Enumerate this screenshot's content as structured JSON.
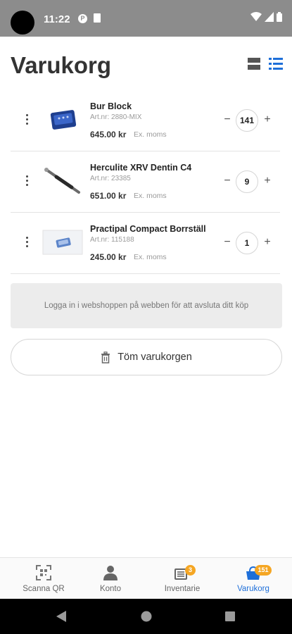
{
  "status_bar": {
    "time": "11:22",
    "icon_p": "P"
  },
  "header": {
    "title": "Varukorg"
  },
  "items": [
    {
      "name": "Bur Block",
      "artnr": "Art.nr: 2880-MIX",
      "price": "645.00 kr",
      "price_note": "Ex. moms",
      "quantity": "141"
    },
    {
      "name": "Herculite XRV Dentin C4",
      "artnr": "Art.nr: 23385",
      "price": "651.00 kr",
      "price_note": "Ex. moms",
      "quantity": "9"
    },
    {
      "name": "Practipal Compact Borrställ",
      "artnr": "Art.nr: 115188",
      "price": "245.00 kr",
      "price_note": "Ex. moms",
      "quantity": "1"
    }
  ],
  "controls": {
    "minus": "−",
    "plus": "+"
  },
  "login_notice": "Logga in i webshoppen på webben för att avsluta ditt köp",
  "empty_cart_label": "Töm varukorgen",
  "bottom_nav": [
    {
      "label": "Scanna QR",
      "icon": "qr-scan-icon"
    },
    {
      "label": "Konto",
      "icon": "person-icon"
    },
    {
      "label": "Inventarie",
      "icon": "inventory-icon",
      "badge": "3"
    },
    {
      "label": "Varukorg",
      "icon": "cart-basket-icon",
      "badge": "151",
      "active": true
    }
  ],
  "colors": {
    "accent": "#1e6fd9",
    "badge": "#f5a623",
    "statusbar": "#8c8c8c"
  }
}
